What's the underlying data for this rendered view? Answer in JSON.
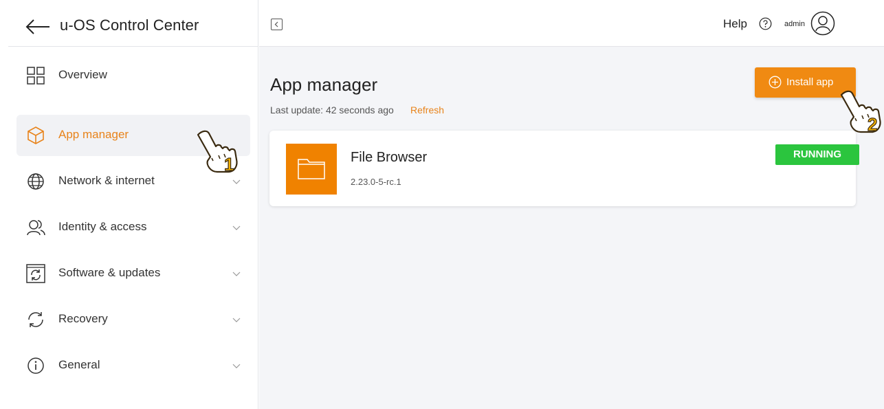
{
  "header": {
    "app_title": "u-OS Control Center",
    "help_label": "Help",
    "user_name": "admin"
  },
  "sidebar": {
    "items": [
      {
        "label": "Overview",
        "icon": "grid-icon",
        "active": false,
        "expandable": false
      },
      {
        "label": "App manager",
        "icon": "box-icon",
        "active": true,
        "expandable": false
      },
      {
        "label": "Network & internet",
        "icon": "globe-icon",
        "active": false,
        "expandable": true
      },
      {
        "label": "Identity & access",
        "icon": "users-icon",
        "active": false,
        "expandable": true
      },
      {
        "label": "Software & updates",
        "icon": "sync-icon",
        "active": false,
        "expandable": true
      },
      {
        "label": "Recovery",
        "icon": "refresh-icon",
        "active": false,
        "expandable": true
      },
      {
        "label": "General",
        "icon": "info-icon",
        "active": false,
        "expandable": true
      }
    ]
  },
  "main": {
    "page_title": "App manager",
    "last_update": "Last update: 42 seconds ago",
    "refresh_label": "Refresh",
    "install_label": "Install app",
    "apps": [
      {
        "name": "File Browser",
        "version": "2.23.0-5-rc.1",
        "status": "RUNNING"
      }
    ]
  },
  "annotations": {
    "step1": "1",
    "step2": "2"
  },
  "colors": {
    "accent": "#f08a12",
    "running": "#2bc53e",
    "app_icon_bg": "#f08200"
  }
}
